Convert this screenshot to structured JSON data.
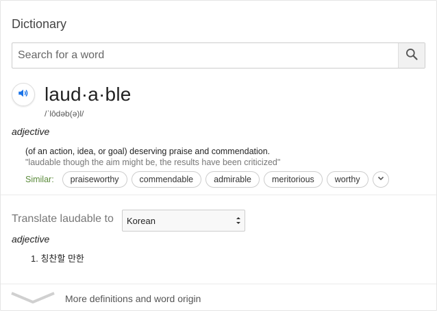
{
  "header": {
    "title": "Dictionary"
  },
  "search": {
    "placeholder": "Search for a word"
  },
  "entry": {
    "headword": "laud·a·ble",
    "phonetic": "/ˈlôdəb(ə)l/",
    "part_of_speech": "adjective",
    "definition": "(of an action, idea, or goal) deserving praise and commendation.",
    "example": "\"laudable though the aim might be, the results have been criticized\"",
    "similar_label": "Similar:",
    "similar": [
      "praiseworthy",
      "commendable",
      "admirable",
      "meritorious",
      "worthy"
    ]
  },
  "translate": {
    "label": "Translate laudable to",
    "language": "Korean",
    "part_of_speech": "adjective",
    "items": [
      "1. 칭찬할 만한"
    ]
  },
  "footer": {
    "more_label": "More definitions and word origin"
  },
  "colors": {
    "accent": "#1a73e8",
    "similar_label": "#5a8a3a",
    "border": "#cccccc"
  },
  "icons": {
    "search": "magnifier-icon",
    "speaker": "speaker-icon",
    "expand": "chevron-down-icon",
    "more": "chevron-down-icon"
  }
}
